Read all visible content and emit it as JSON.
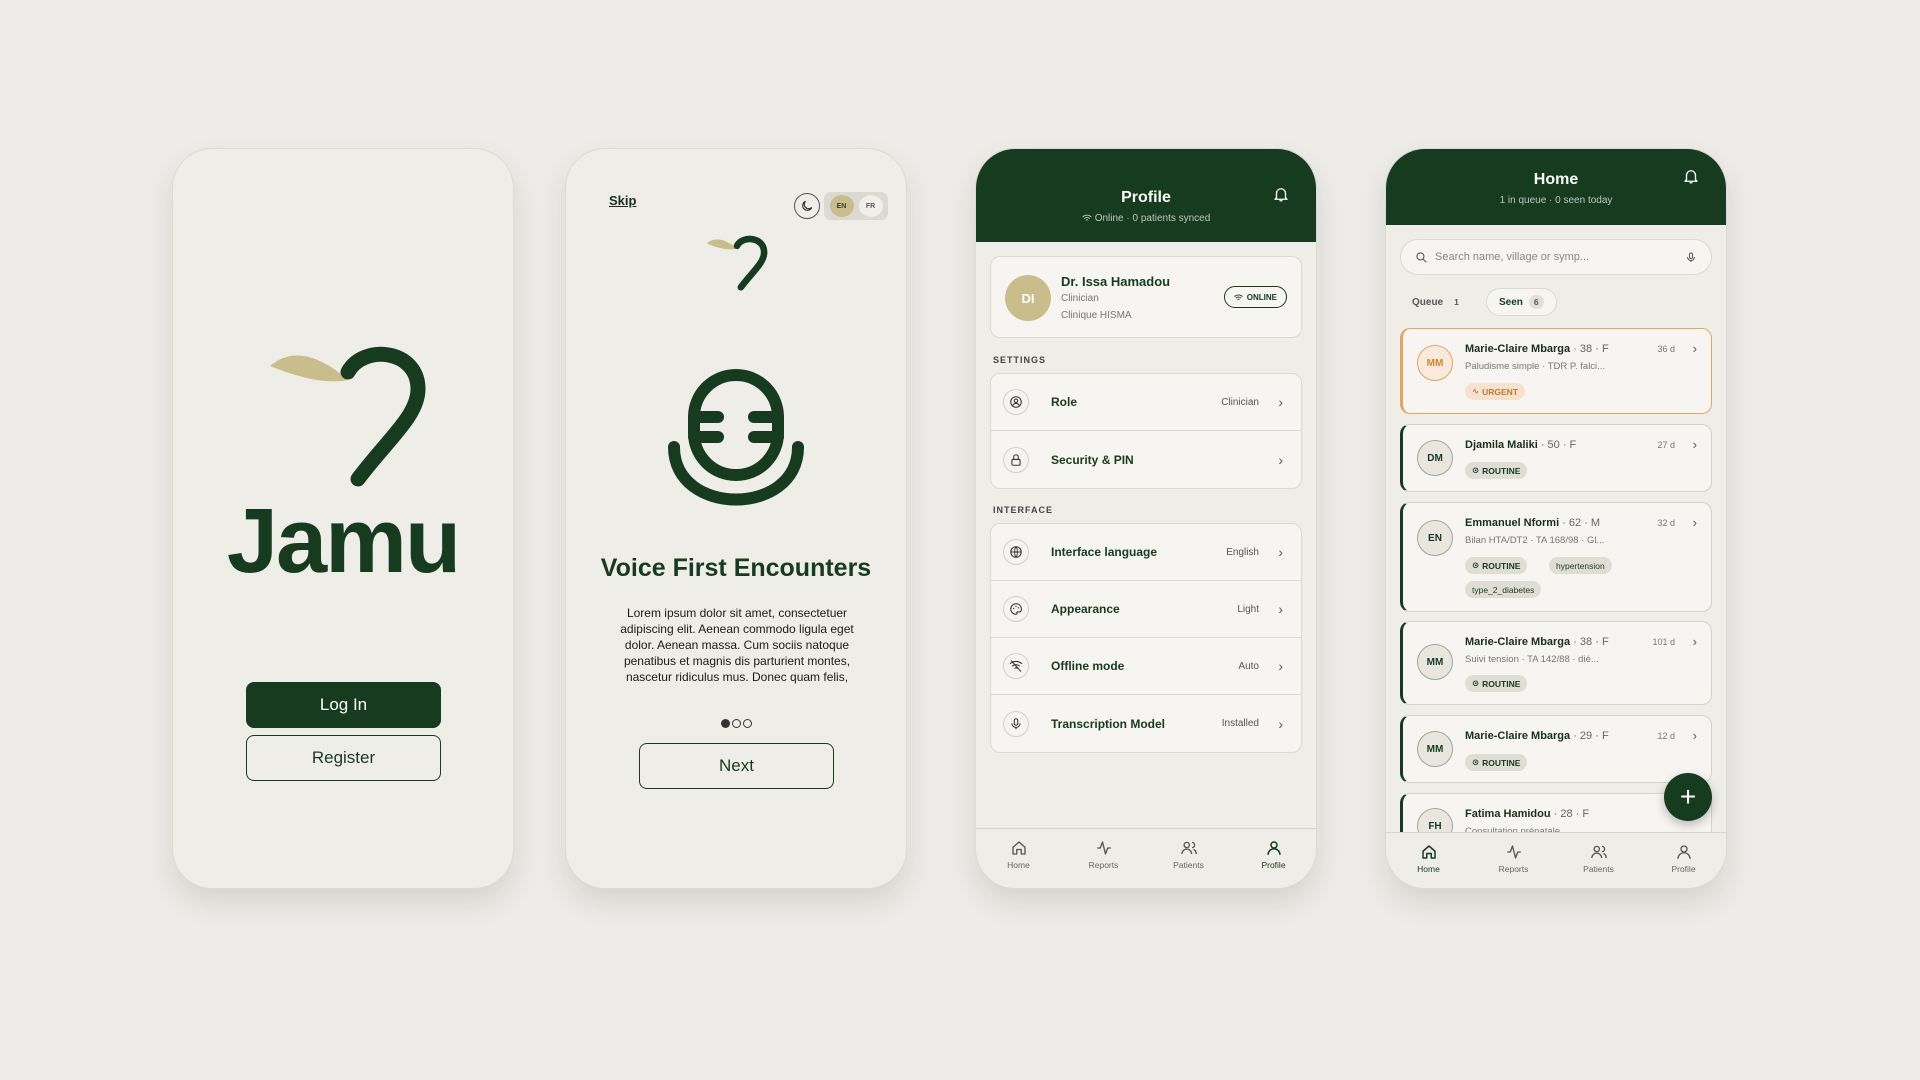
{
  "welcome": {
    "brand": "Jamu",
    "login_label": "Log In",
    "register_label": "Register"
  },
  "onboarding": {
    "skip_label": "Skip",
    "lang_en": "EN",
    "lang_fr": "FR",
    "title": "Voice First Encounters",
    "body": "Lorem ipsum dolor sit amet, consectetuer adipiscing elit. Aenean commodo ligula eget dolor. Aenean massa. Cum sociis natoque penatibus et magnis dis parturient montes, nascetur ridiculus mus. Donec quam felis,",
    "next_label": "Next",
    "page_current": 1,
    "page_total": 3
  },
  "profile": {
    "title": "Profile",
    "subtitle": "Online · 0 patients synced",
    "user": {
      "initials": "DI",
      "name": "Dr. Issa Hamadou",
      "role": "Clinician",
      "clinic": "Clinique HISMA",
      "status": "ONLINE"
    },
    "settings_label": "SETTINGS",
    "settings": [
      {
        "label": "Role",
        "value": "Clinician"
      },
      {
        "label": "Security & PIN",
        "value": ""
      }
    ],
    "interface_label": "INTERFACE",
    "interface": [
      {
        "label": "Interface language",
        "value": "English"
      },
      {
        "label": "Appearance",
        "value": "Light"
      },
      {
        "label": "Offline mode",
        "value": "Auto"
      },
      {
        "label": "Transcription Model",
        "value": "Installed"
      }
    ]
  },
  "tabs": [
    {
      "label": "Home"
    },
    {
      "label": "Reports"
    },
    {
      "label": "Patients"
    },
    {
      "label": "Profile"
    }
  ],
  "home": {
    "title": "Home",
    "subtitle": "1 in queue · 0 seen today",
    "search_placeholder": "Search name, village or symp...",
    "queue_label": "Queue",
    "queue_count": "1",
    "seen_label": "Seen",
    "seen_count": "6",
    "patients": [
      {
        "initials": "MM",
        "name": "Marie-Claire Mbarga",
        "meta": " · 38 · F",
        "sub": "Paludisme simple · TDR P. falci...",
        "days": "36 d",
        "tags": [
          "URGENT"
        ]
      },
      {
        "initials": "DM",
        "name": "Djamila Maliki",
        "meta": " · 50 · F",
        "sub": "",
        "days": "27 d",
        "tags": [
          "ROUTINE"
        ]
      },
      {
        "initials": "EN",
        "name": "Emmanuel Nformi",
        "meta": " · 62 · M",
        "sub": "Bilan HTA/DT2 · TA 168/98 · Gl...",
        "days": "32 d",
        "tags": [
          "ROUTINE",
          "hypertension",
          "type_2_diabetes"
        ]
      },
      {
        "initials": "MM",
        "name": "Marie-Claire Mbarga",
        "meta": " · 38 · F",
        "sub": "Suivi tension · TA 142/88 · dié...",
        "days": "101 d",
        "tags": [
          "ROUTINE"
        ]
      },
      {
        "initials": "MM",
        "name": "Marie-Claire Mbarga",
        "meta": " · 29 · F",
        "sub": "",
        "days": "12 d",
        "tags": [
          "ROUTINE"
        ]
      },
      {
        "initials": "FH",
        "name": "Fatima Hamidou",
        "meta": " · 28 · F",
        "sub": "Consultation prénatale",
        "days": "",
        "tags": []
      }
    ],
    "fab_label": "+"
  },
  "colors": {
    "primary": "#173b1f",
    "accent_gold": "#c9bd8b",
    "urgent": "#e8a45c",
    "background": "#eeece8"
  }
}
